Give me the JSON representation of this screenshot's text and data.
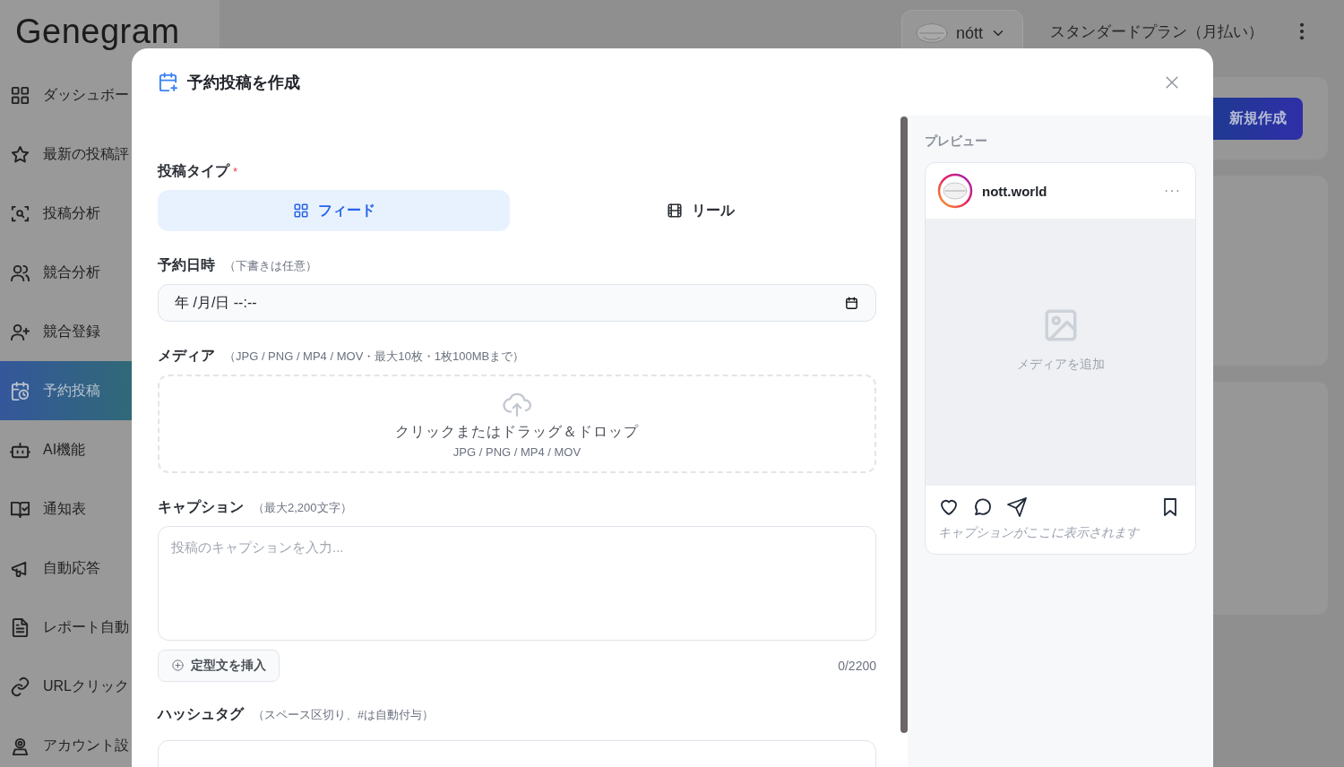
{
  "app": {
    "logo": "Genegram",
    "account": {
      "name": "nótt"
    },
    "plan": "スタンダードプラン（月払い）",
    "new_button": "新規作成"
  },
  "sidebar": {
    "items": [
      {
        "label": "ダッシュボー",
        "selected": false
      },
      {
        "label": "最新の投稿評",
        "selected": false
      },
      {
        "label": "投稿分析",
        "selected": false
      },
      {
        "label": "競合分析",
        "selected": false
      },
      {
        "label": "競合登録",
        "selected": false
      },
      {
        "label": "予約投稿",
        "selected": true
      },
      {
        "label": "AI機能",
        "selected": false
      },
      {
        "label": "通知表",
        "selected": false
      },
      {
        "label": "自動応答",
        "selected": false
      },
      {
        "label": "レポート自動",
        "selected": false
      },
      {
        "label": "URLクリック",
        "selected": false
      },
      {
        "label": "アカウント設",
        "selected": false
      }
    ]
  },
  "modal": {
    "title": "予約投稿を作成",
    "post_type": {
      "label": "投稿タイプ",
      "required_mark": "*",
      "options": [
        {
          "label": "フィード",
          "selected": true
        },
        {
          "label": "リール",
          "selected": false
        }
      ]
    },
    "schedule": {
      "label": "予約日時",
      "hint": "（下書きは任意）",
      "value": "年 /月/日 --:--"
    },
    "media": {
      "label": "メディア",
      "hint": "（JPG / PNG / MP4 / MOV・最大10枚・1枚100MBまで）",
      "drop_text": "クリックまたはドラッグ＆ドロップ",
      "drop_formats": "JPG / PNG / MP4 / MOV"
    },
    "caption": {
      "label": "キャプション",
      "hint": "（最大2,200文字）",
      "placeholder": "投稿のキャプションを入力...",
      "template_button": "定型文を挿入",
      "counter": "0/2200"
    },
    "hashtags": {
      "label": "ハッシュタグ",
      "hint": "（スペース区切り、#は自動付与）"
    },
    "preview": {
      "label": "プレビュー",
      "username": "nott.world",
      "more": "···",
      "media_text": "メディアを追加",
      "caption_preview": "キャプションがここに表示されます"
    }
  }
}
